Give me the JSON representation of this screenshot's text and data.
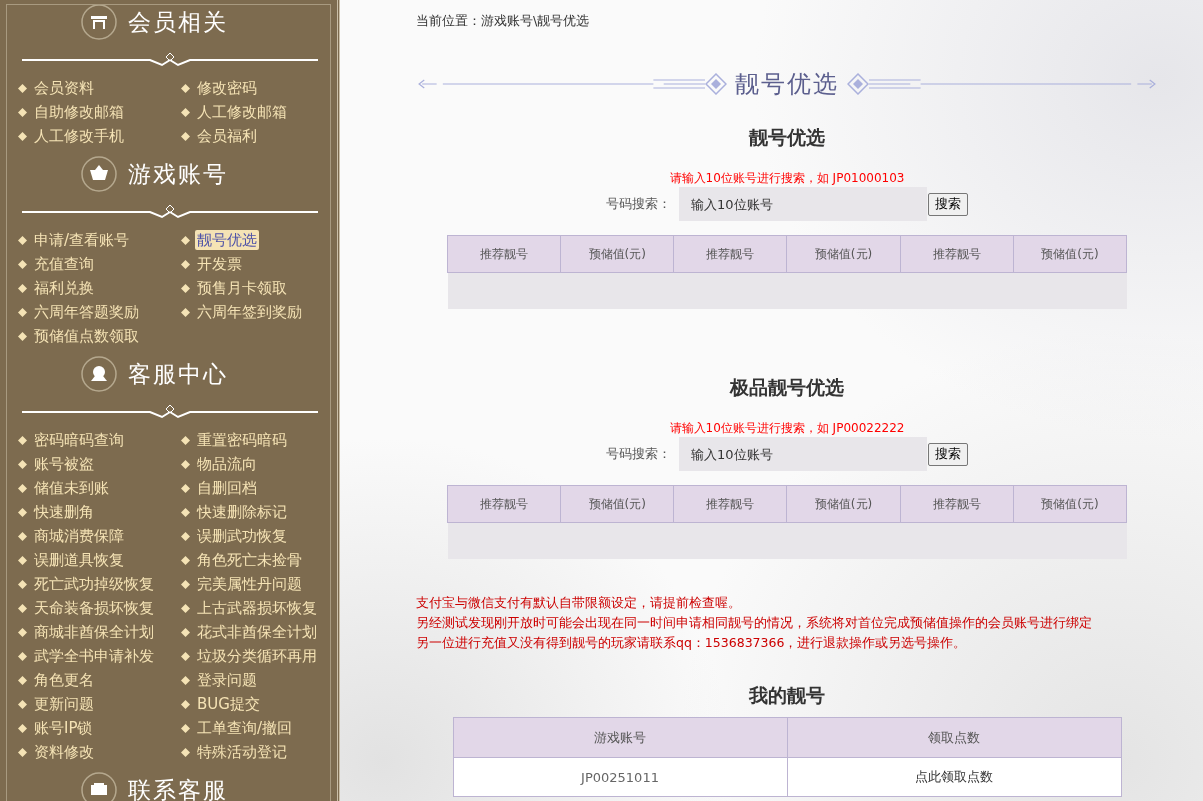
{
  "sidebar": {
    "sections": [
      {
        "title": "会员相关",
        "items": [
          {
            "label": "会员资料",
            "selected": false
          },
          {
            "label": "修改密码",
            "selected": false
          },
          {
            "label": "自助修改邮箱",
            "selected": false
          },
          {
            "label": "人工修改邮箱",
            "selected": false
          },
          {
            "label": "人工修改手机",
            "selected": false
          },
          {
            "label": "会员福利",
            "selected": false
          }
        ]
      },
      {
        "title": "游戏账号",
        "items": [
          {
            "label": "申请/查看账号",
            "selected": false
          },
          {
            "label": "靓号优选",
            "selected": true
          },
          {
            "label": "充值查询",
            "selected": false
          },
          {
            "label": "开发票",
            "selected": false
          },
          {
            "label": "福利兑换",
            "selected": false
          },
          {
            "label": "预售月卡领取",
            "selected": false
          },
          {
            "label": "六周年答题奖励",
            "selected": false
          },
          {
            "label": "六周年签到奖励",
            "selected": false
          },
          {
            "label": "预储值点数领取",
            "selected": false
          }
        ]
      },
      {
        "title": "客服中心",
        "items": [
          {
            "label": "密码暗码查询",
            "selected": false
          },
          {
            "label": "重置密码暗码",
            "selected": false
          },
          {
            "label": "账号被盗",
            "selected": false
          },
          {
            "label": "物品流向",
            "selected": false
          },
          {
            "label": "储值未到账",
            "selected": false
          },
          {
            "label": "自删回档",
            "selected": false
          },
          {
            "label": "快速删角",
            "selected": false
          },
          {
            "label": "快速删除标记",
            "selected": false
          },
          {
            "label": "商城消费保障",
            "selected": false
          },
          {
            "label": "误删武功恢复",
            "selected": false
          },
          {
            "label": "误删道具恢复",
            "selected": false
          },
          {
            "label": "角色死亡未捡骨",
            "selected": false
          },
          {
            "label": "死亡武功掉级恢复",
            "selected": false
          },
          {
            "label": "完美属性丹问题",
            "selected": false
          },
          {
            "label": "天命装备损坏恢复",
            "selected": false
          },
          {
            "label": "上古武器损坏恢复",
            "selected": false
          },
          {
            "label": "商城非酋保全计划",
            "selected": false
          },
          {
            "label": "花式非酋保全计划",
            "selected": false
          },
          {
            "label": "武学全书申请补发",
            "selected": false
          },
          {
            "label": "垃圾分类循环再用",
            "selected": false
          },
          {
            "label": "角色更名",
            "selected": false
          },
          {
            "label": "登录问题",
            "selected": false
          },
          {
            "label": "更新问题",
            "selected": false
          },
          {
            "label": "BUG提交",
            "selected": false
          },
          {
            "label": "账号IP锁",
            "selected": false
          },
          {
            "label": "工单查询/撤回",
            "selected": false
          },
          {
            "label": "资料修改",
            "selected": false
          },
          {
            "label": "特殊活动登记",
            "selected": false
          }
        ]
      },
      {
        "title": "联系客服"
      }
    ]
  },
  "breadcrumb": "当前位置：游戏账号\\靓号优选",
  "banner_title": "靓号优选",
  "search_sections": [
    {
      "title": "靓号优选",
      "hint": "请输入10位账号进行搜索，如 JP01000103",
      "search_label": "号码搜索：",
      "placeholder": "输入10位账号",
      "button": "搜索",
      "columns": [
        "推荐靓号",
        "预储值(元)",
        "推荐靓号",
        "预储值(元)",
        "推荐靓号",
        "预储值(元)"
      ]
    },
    {
      "title": "极品靓号优选",
      "hint": "请输入10位账号进行搜索，如 JP00022222",
      "search_label": "号码搜索：",
      "placeholder": "输入10位账号",
      "button": "搜索",
      "columns": [
        "推荐靓号",
        "预储值(元)",
        "推荐靓号",
        "预储值(元)",
        "推荐靓号",
        "预储值(元)"
      ]
    }
  ],
  "notes": [
    "支付宝与微信支付有默认自带限额设定，请提前检查喔。",
    "另经测试发现刚开放时可能会出现在同一时间申请相同靓号的情况，系统将对首位完成预储值操作的会员账号进行绑定",
    "另一位进行充值又没有得到靓号的玩家请联系qq：1536837366，进行退款操作或另选号操作。"
  ],
  "my_numbers": {
    "title": "我的靓号",
    "columns": [
      "游戏账号",
      "领取点数"
    ],
    "rows": [
      [
        "JP00251011",
        "点此领取点数"
      ]
    ]
  }
}
